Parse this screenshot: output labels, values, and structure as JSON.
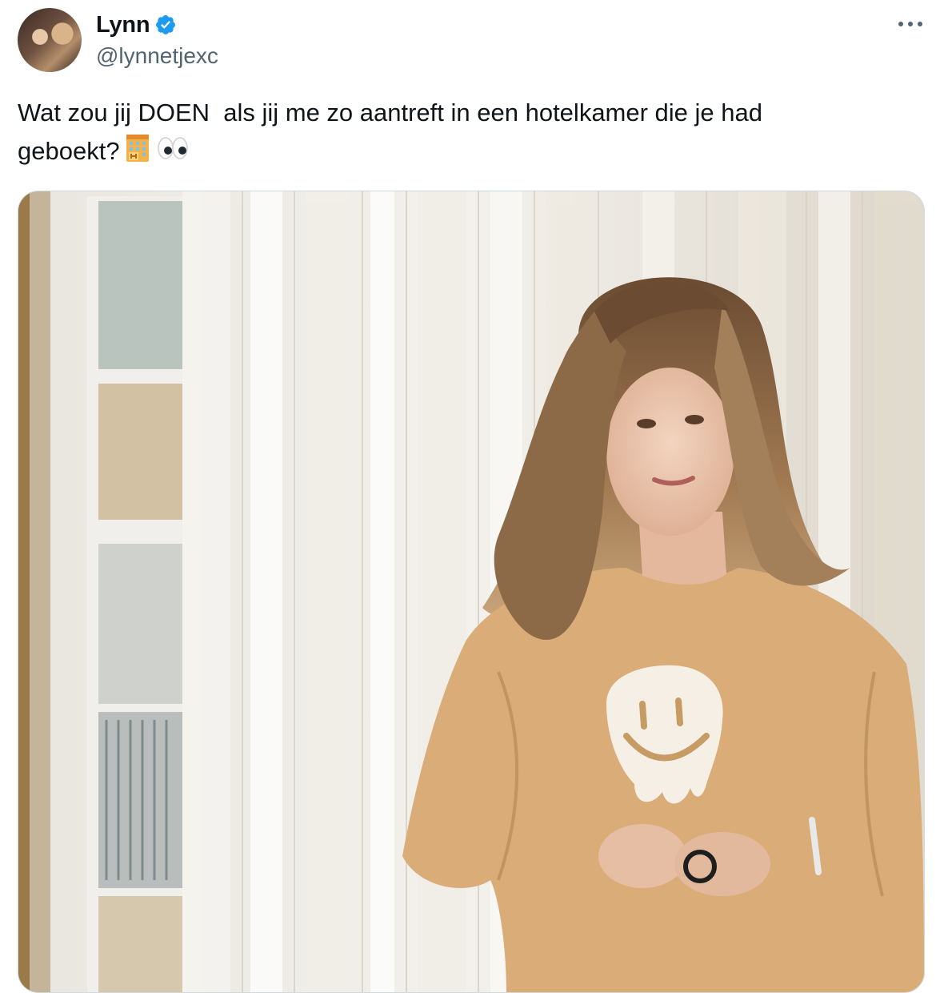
{
  "author": {
    "display_name": "Lynn",
    "handle": "@lynnetjexc",
    "verified": true,
    "avatar_icon": "profile-photo-avatar"
  },
  "tweet": {
    "text": "Wat zou jij DOEN  als jij me zo aantreft in een hotelkamer die je had\ngeboekt?",
    "emojis": [
      "hotel-emoji",
      "eyes-emoji"
    ]
  },
  "more_menu_icon": "more-horizontal-icon",
  "colors": {
    "text_primary": "#0f1419",
    "text_secondary": "#536471",
    "verified_blue": "#1d9bf0",
    "border": "#cfd9de"
  }
}
